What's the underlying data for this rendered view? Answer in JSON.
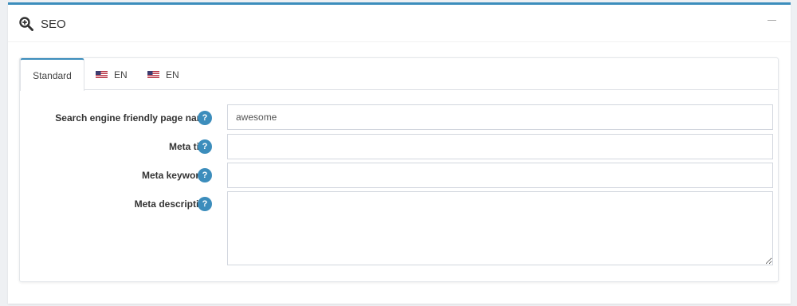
{
  "panel": {
    "title": "SEO",
    "icon": "search-plus-icon",
    "collapse_icon": "minus-icon"
  },
  "tabs": [
    {
      "label": "Standard",
      "active": true
    },
    {
      "label": "EN",
      "flag": "us-flag-icon"
    },
    {
      "label": "EN",
      "flag": "us-flag-icon"
    }
  ],
  "form": {
    "fields": [
      {
        "label": "Search engine friendly page name",
        "value": "awesome",
        "help": "?"
      },
      {
        "label": "Meta title",
        "value": "",
        "help": "?"
      },
      {
        "label": "Meta keywords",
        "value": "",
        "help": "?"
      },
      {
        "label": "Meta description",
        "value": "",
        "help": "?"
      }
    ]
  },
  "colors": {
    "accent": "#3c8dbc",
    "background": "#eef0f3",
    "border": "#d2d6de"
  }
}
